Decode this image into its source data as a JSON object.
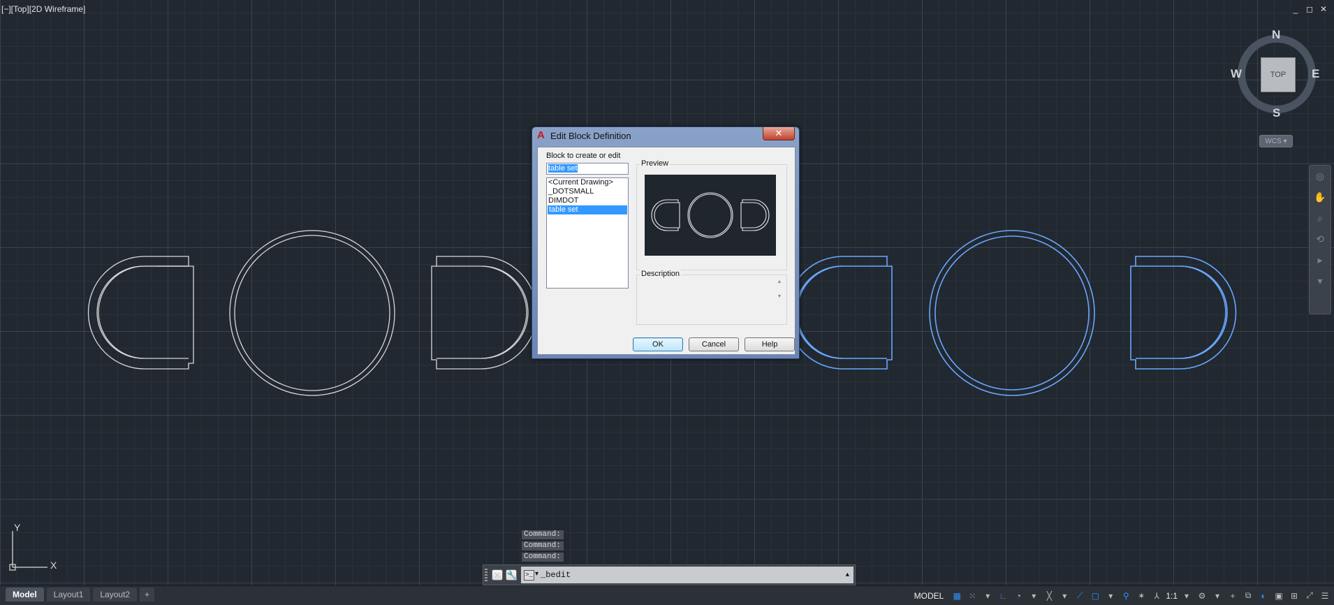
{
  "viewport": {
    "label": "[−][Top][2D Wireframe]",
    "window_controls": [
      "_",
      "◻",
      "✕"
    ]
  },
  "viewcube": {
    "top": "TOP",
    "n": "N",
    "s": "S",
    "e": "E",
    "w": "W",
    "wcs": "WCS ▾"
  },
  "ucs": {
    "x": "X",
    "y": "Y"
  },
  "command": {
    "history": [
      "Command:",
      "Command:",
      "Command:"
    ],
    "input": "_bedit"
  },
  "status": {
    "tabs": [
      "Model",
      "Layout1",
      "Layout2",
      "+"
    ],
    "model_label": "MODEL",
    "scale": "1:1"
  },
  "dialog": {
    "title": "Edit Block Definition",
    "block_label": "Block to create or edit",
    "block_name": "table set",
    "blocks": [
      "<Current Drawing>",
      "_DOTSMALL",
      "DIMDOT",
      "table set"
    ],
    "selected_index": 3,
    "preview_label": "Preview",
    "description_label": "Description",
    "description": "",
    "ok": "OK",
    "cancel": "Cancel",
    "help": "Help"
  },
  "colors": {
    "background": "#212830",
    "selection_blue": "#3399ff",
    "highlight_geometry": "#6aa7ff"
  }
}
